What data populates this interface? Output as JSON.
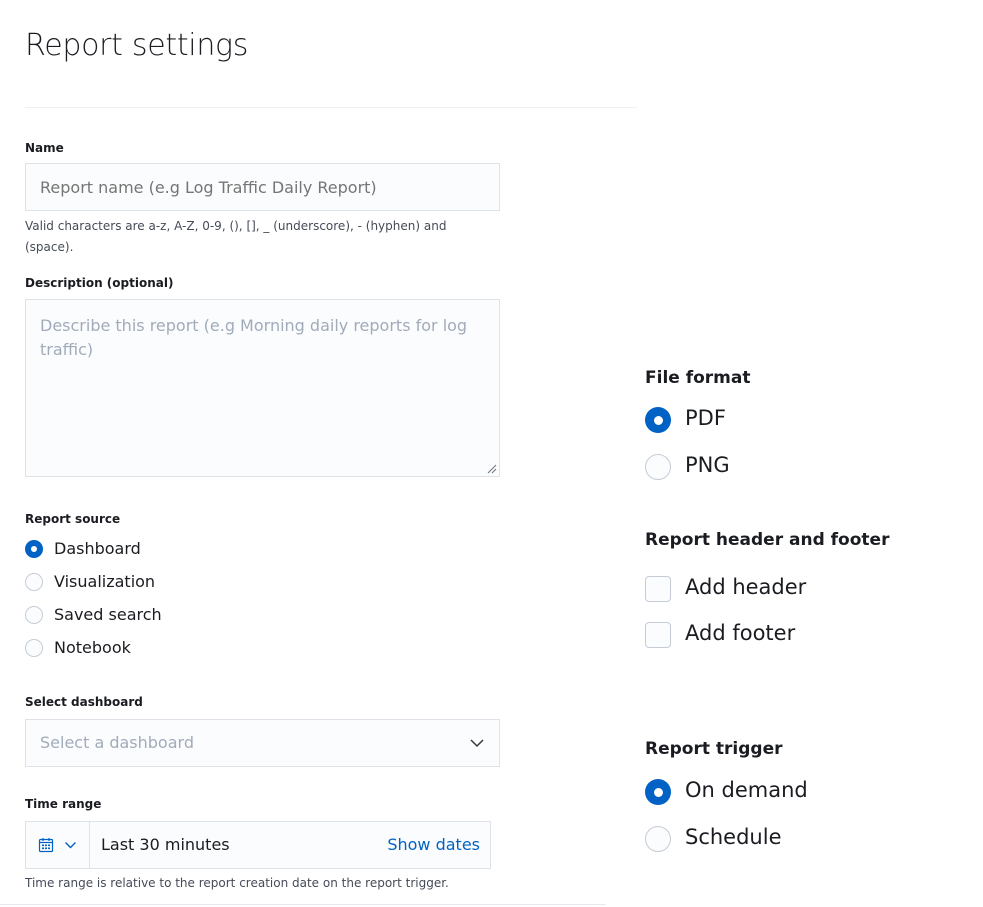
{
  "page": {
    "title": "Report settings"
  },
  "name": {
    "label": "Name",
    "placeholder": "Report name (e.g Log Traffic Daily Report)",
    "value": "",
    "help_line1": "Valid characters are a-z, A-Z, 0-9, (), [], _ (underscore), - (hyphen) and",
    "help_line2": "(space)."
  },
  "description": {
    "label": "Description (optional)",
    "placeholder": "Describe this report (e.g Morning daily reports for log traffic)",
    "value": ""
  },
  "report_source": {
    "label": "Report source",
    "options": [
      {
        "label": "Dashboard",
        "checked": true
      },
      {
        "label": "Visualization",
        "checked": false
      },
      {
        "label": "Saved search",
        "checked": false
      },
      {
        "label": "Notebook",
        "checked": false
      }
    ]
  },
  "select_dashboard": {
    "label": "Select dashboard",
    "placeholder": "Select a dashboard",
    "chevron_icon": "chevron-down-icon"
  },
  "time_range": {
    "label": "Time range",
    "value": "Last 30 minutes",
    "show_dates": "Show dates",
    "help": "Time range is relative to the report creation date on the report trigger.",
    "calendar_icon": "calendar-icon"
  },
  "file_format": {
    "title": "File format",
    "options": [
      {
        "label": "PDF",
        "checked": true
      },
      {
        "label": "PNG",
        "checked": false
      }
    ]
  },
  "header_footer": {
    "title": "Report header and footer",
    "options": [
      {
        "label": "Add header",
        "checked": false
      },
      {
        "label": "Add footer",
        "checked": false
      }
    ]
  },
  "report_trigger": {
    "title": "Report trigger",
    "options": [
      {
        "label": "On demand",
        "checked": true
      },
      {
        "label": "Schedule",
        "checked": false
      }
    ]
  },
  "colors": {
    "accent": "#0062c4",
    "border": "#dfe3e9",
    "field_bg": "#fbfcfd",
    "placeholder": "#a2abba"
  }
}
